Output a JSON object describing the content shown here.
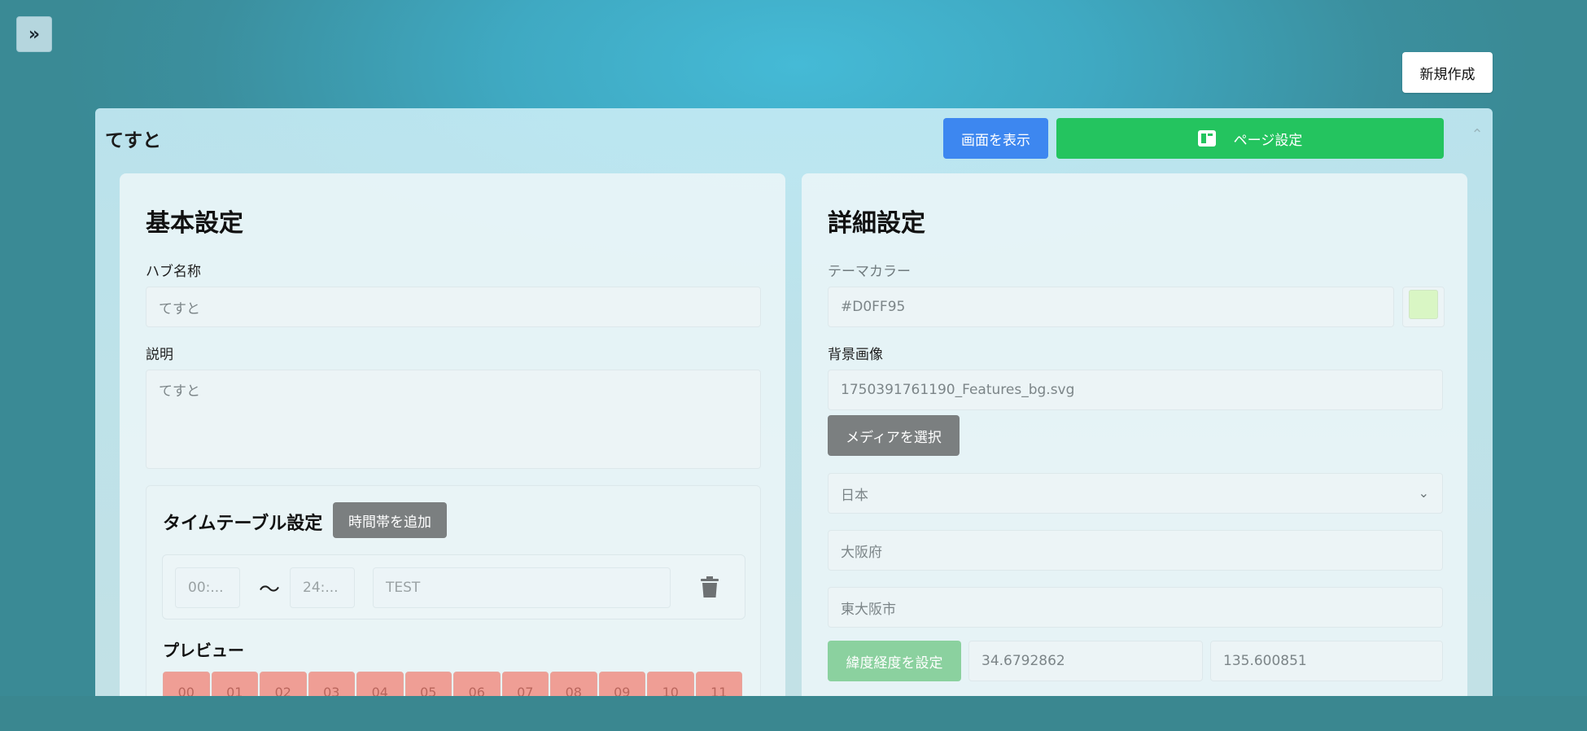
{
  "toolbar": {
    "new_label": "新規作成"
  },
  "hub": {
    "title": "てすと",
    "view_label": "画面を表示",
    "page_settings_label": "ページ設定"
  },
  "basic": {
    "title": "基本設定",
    "name_label": "ハブ名称",
    "name_value": "てすと",
    "desc_label": "説明",
    "desc_value": "てすと",
    "timetable": {
      "title": "タイムテーブル設定",
      "add_label": "時間帯を追加",
      "start": "00:...",
      "tilde": "〜",
      "end": "24:...",
      "slot_name": "TEST",
      "preview_title": "プレビュー",
      "hours": [
        "00",
        "01",
        "02",
        "03",
        "04",
        "05",
        "06",
        "07",
        "08",
        "09",
        "10",
        "11"
      ]
    }
  },
  "detail": {
    "title": "詳細設定",
    "theme_label": "テーマカラー",
    "theme_value": "#D0FF95",
    "bg_label": "背景画像",
    "bg_value": "1750391761190_Features_bg.svg",
    "media_label": "メディアを選択",
    "country": "日本",
    "prefecture": "大阪府",
    "city": "東大阪市",
    "latlng_label": "緯度経度を設定",
    "lat": "34.6792862",
    "lng": "135.600851"
  },
  "colors": {
    "accent_blue": "#3d87f0",
    "accent_green": "#24c45f",
    "swatch": "#d9f6c4"
  }
}
